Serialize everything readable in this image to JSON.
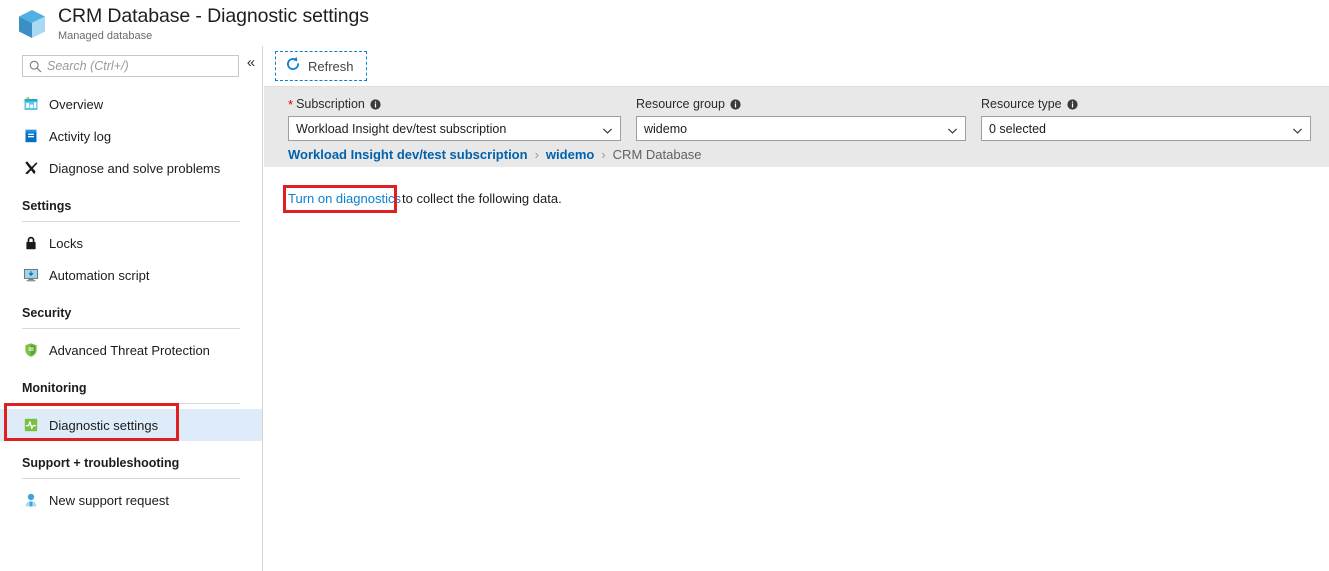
{
  "header": {
    "icon": "cube-icon",
    "title": "CRM Database - Diagnostic settings",
    "subtitle": "Managed database"
  },
  "sidebar": {
    "search": {
      "icon": "search-icon",
      "placeholder": "Search (Ctrl+/)",
      "value": ""
    },
    "collapse": {
      "icon": "double-chevron-left-icon",
      "label": "«"
    },
    "items": [
      {
        "label": "Overview",
        "icon": "overview-icon",
        "selected": false
      },
      {
        "label": "Activity log",
        "icon": "activity-log-icon",
        "selected": false
      },
      {
        "label": "Diagnose and solve problems",
        "icon": "wrench-screwdriver-icon",
        "selected": false
      }
    ],
    "sections": [
      {
        "title": "Settings",
        "items": [
          {
            "label": "Locks",
            "icon": "lock-icon",
            "selected": false
          },
          {
            "label": "Automation script",
            "icon": "automation-script-icon",
            "selected": false
          }
        ]
      },
      {
        "title": "Security",
        "items": [
          {
            "label": "Advanced Threat Protection",
            "icon": "shield-icon",
            "selected": false
          }
        ]
      },
      {
        "title": "Monitoring",
        "items": [
          {
            "label": "Diagnostic settings",
            "icon": "diagnostic-settings-icon",
            "selected": true
          }
        ]
      },
      {
        "title": "Support + troubleshooting",
        "items": [
          {
            "label": "New support request",
            "icon": "support-request-icon",
            "selected": false
          }
        ]
      }
    ]
  },
  "toolbar": {
    "refresh_label": "Refresh",
    "refresh_icon": "refresh-icon"
  },
  "filters": {
    "subscription": {
      "label": "Subscription",
      "required_marker": "*",
      "info_icon": "info-icon",
      "value": "Workload Insight dev/test subscription",
      "chevron_icon": "chevron-down-icon"
    },
    "resource_group": {
      "label": "Resource group",
      "info_icon": "info-icon",
      "value": "widemo",
      "chevron_icon": "chevron-down-icon"
    },
    "resource_type": {
      "label": "Resource type",
      "info_icon": "info-icon",
      "value": "0 selected",
      "chevron_icon": "chevron-down-icon"
    }
  },
  "breadcrumb": {
    "separator": "›",
    "items": [
      {
        "label": "Workload Insight dev/test subscription",
        "is_link": true
      },
      {
        "label": "widemo",
        "is_link": true
      },
      {
        "label": "CRM Database",
        "is_link": false
      }
    ]
  },
  "message": {
    "link_text": "Turn on diagnostics",
    "rest_text": " to collect the following data."
  },
  "colors": {
    "accent_blue": "#0a7fd4",
    "link_blue": "#0062ad",
    "selection_bg": "#deecf9",
    "annotation_red": "#e02020",
    "filter_bar_bg": "#e8e8e8",
    "required_red": "#d60000"
  }
}
